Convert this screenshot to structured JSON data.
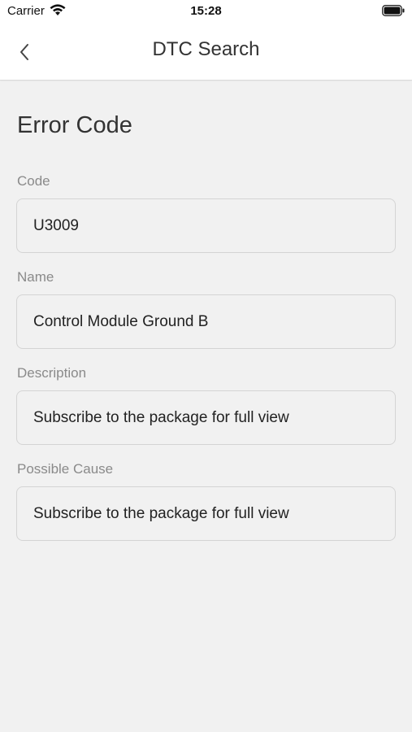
{
  "status_bar": {
    "carrier": "Carrier",
    "time": "15:28",
    "icons": [
      "wifi-icon",
      "battery-icon"
    ]
  },
  "nav": {
    "title": "DTC Search",
    "back_icon": "chevron-left-icon"
  },
  "section": {
    "title": "Error Code"
  },
  "fields": [
    {
      "label": "Code",
      "value": "U3009"
    },
    {
      "label": "Name",
      "value": "Control Module Ground B"
    },
    {
      "label": "Description",
      "value": "Subscribe to the package for full view"
    },
    {
      "label": "Possible Cause",
      "value": "Subscribe to the package for full view"
    }
  ],
  "colors": {
    "background": "#f1f1f1",
    "bar": "#ffffff",
    "label": "#8a8a8a",
    "border": "#d4d4d4"
  }
}
